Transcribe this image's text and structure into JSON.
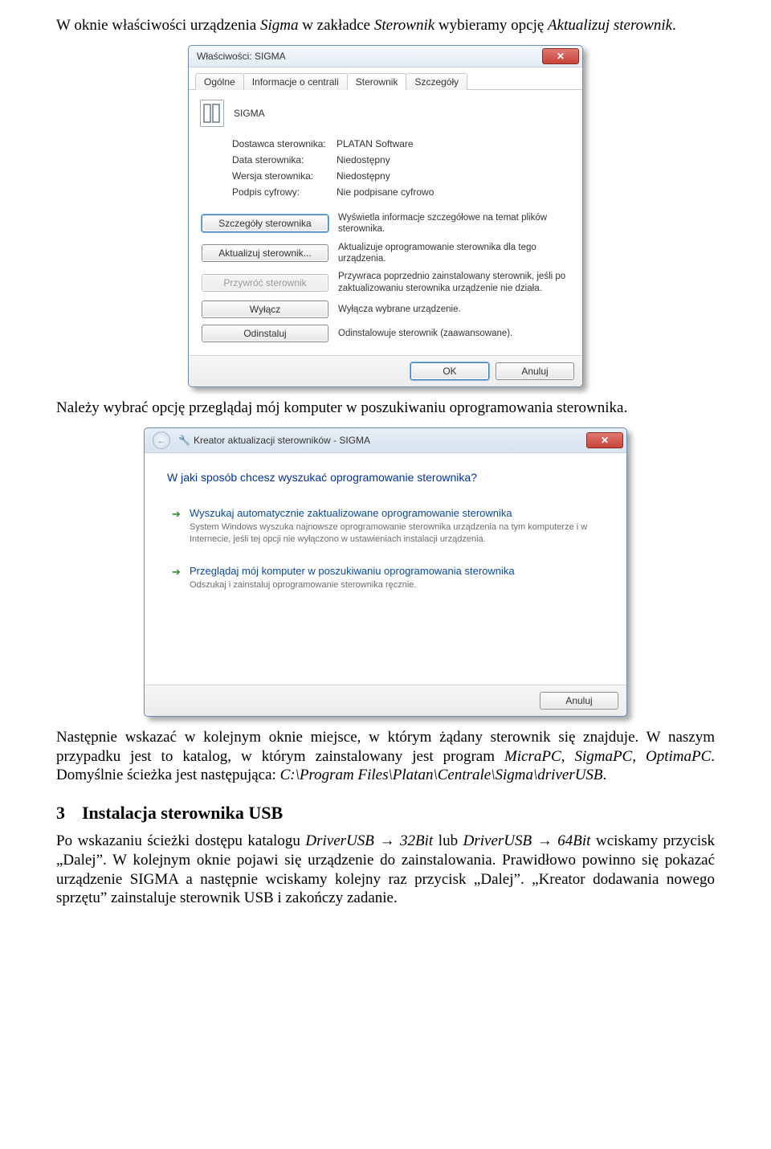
{
  "para1_a": "W oknie właściwości urządzenia ",
  "para1_b": "Sigma",
  "para1_c": " w zakładce ",
  "para1_d": "Sterownik",
  "para1_e": " wybieramy opcję ",
  "para1_f": "Aktualizuj sterownik",
  "para1_g": ".",
  "dlg1": {
    "title": "Właściwości: SIGMA",
    "tabs": [
      "Ogólne",
      "Informacje o centrali",
      "Sterownik",
      "Szczegóły"
    ],
    "device": "SIGMA",
    "info": {
      "k1": "Dostawca sterownika:",
      "v1": "PLATAN Software",
      "k2": "Data sterownika:",
      "v2": "Niedostępny",
      "k3": "Wersja sterownika:",
      "v3": "Niedostępny",
      "k4": "Podpis cyfrowy:",
      "v4": "Nie podpisane cyfrowo"
    },
    "buttons": {
      "b1": "Szczegóły sterownika",
      "d1": "Wyświetla informacje szczegółowe na temat plików sterownika.",
      "b2": "Aktualizuj sterownik...",
      "d2": "Aktualizuje oprogramowanie sterownika dla tego urządzenia.",
      "b3": "Przywróć sterownik",
      "d3": "Przywraca poprzednio zainstalowany sterownik, jeśli po zaktualizowaniu sterownika urządzenie nie działa.",
      "b4": "Wyłącz",
      "d4": "Wyłącza wybrane urządzenie.",
      "b5": "Odinstaluj",
      "d5": "Odinstalowuje sterownik (zaawansowane)."
    },
    "ok": "OK",
    "cancel": "Anuluj"
  },
  "para2": "Należy wybrać opcję przeglądaj mój komputer w poszukiwaniu oprogramowania sterownika.",
  "dlg2": {
    "title": "Kreator aktualizacji sterowników - SIGMA",
    "question": "W jaki sposób chcesz wyszukać oprogramowanie sterownika?",
    "opt1_title": "Wyszukaj automatycznie zaktualizowane oprogramowanie sterownika",
    "opt1_sub": "System Windows wyszuka najnowsze oprogramowanie sterownika urządzenia na tym komputerze i w Internecie, jeśli tej opcji nie wyłączono w ustawieniach instalacji urządzenia.",
    "opt2_title": "Przeglądaj mój komputer w poszukiwaniu oprogramowania sterownika",
    "opt2_sub": "Odszukaj i zainstaluj oprogramowanie sterownika ręcznie.",
    "cancel": "Anuluj"
  },
  "para3_a": "Następnie wskazać w kolejnym oknie miejsce, w którym żądany sterownik się znajduje. W naszym przypadku jest to katalog, w którym zainstalowany jest program ",
  "para3_b": "MicraPC",
  "para3_c": ", ",
  "para3_d": "SigmaPC, OptimaPC",
  "para3_e": ". Domyślnie ścieżka jest następująca: ",
  "para3_f": "C:\\Program Files\\Platan\\Centrale\\Sigma\\driverUSB",
  "para3_g": ".",
  "heading_num": "3",
  "heading_text": "Instalacja sterownika USB",
  "para4_a": "Po wskazaniu ścieżki dostępu katalogu ",
  "para4_b": "DriverUSB → 32Bit",
  "para4_c": " lub ",
  "para4_d": "DriverUSB → 64Bit",
  "para4_e": " wciskamy przycisk „Dalej”. W kolejnym oknie pojawi się urządzenie do zainstalowania. Prawidłowo powinno się pokazać urządzenie SIGMA a następnie wciskamy kolejny raz przycisk „Dalej”. „Kreator dodawania nowego sprzętu” zainstaluje sterownik USB i zakończy zadanie."
}
